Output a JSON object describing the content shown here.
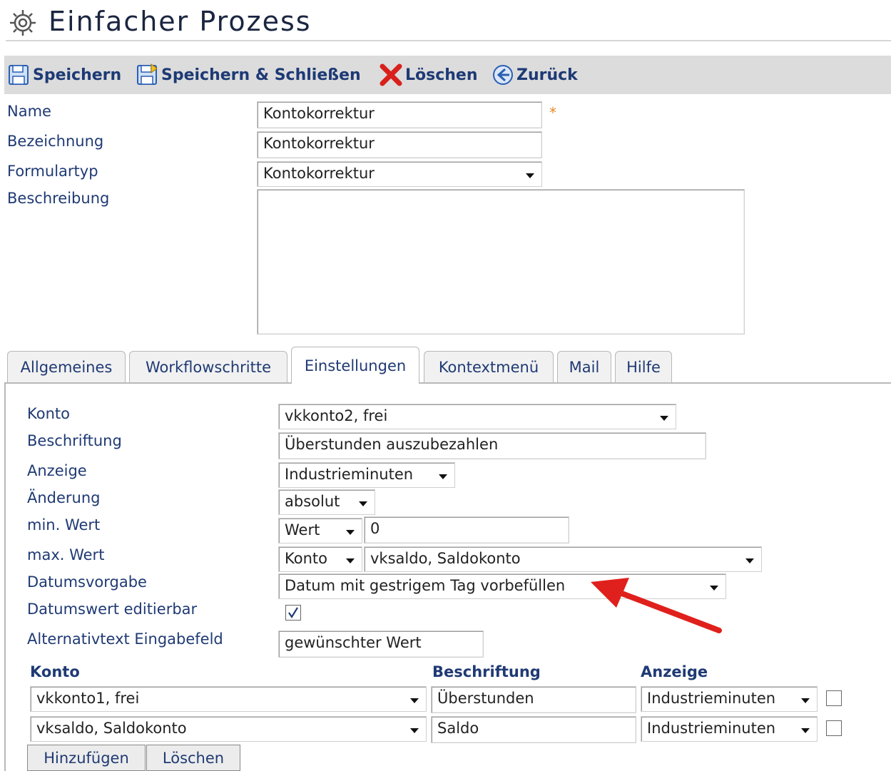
{
  "page": {
    "title": "Einfacher Prozess"
  },
  "toolbar": {
    "save": "Speichern",
    "save_close": "Speichern & Schließen",
    "delete": "Löschen",
    "back": "Zurück"
  },
  "form": {
    "name_label": "Name",
    "name_value": "Kontokorrektur",
    "required_mark": "*",
    "bezeichnung_label": "Bezeichnung",
    "bezeichnung_value": "Kontokorrektur",
    "formulartyp_label": "Formulartyp",
    "formulartyp_value": "Kontokorrektur",
    "beschreibung_label": "Beschreibung",
    "beschreibung_value": ""
  },
  "tabs": [
    {
      "label": "Allgemeines"
    },
    {
      "label": "Workflowschritte"
    },
    {
      "label": "Einstellungen"
    },
    {
      "label": "Kontextmenü"
    },
    {
      "label": "Mail"
    },
    {
      "label": "Hilfe"
    }
  ],
  "settings": {
    "konto_label": "Konto",
    "konto_value": "vkkonto2, frei",
    "beschriftung_label": "Beschriftung",
    "beschriftung_value": "Überstunden auszubezahlen",
    "anzeige_label": "Anzeige",
    "anzeige_value": "Industrieminuten",
    "aenderung_label": "Änderung",
    "aenderung_value": "absolut",
    "min_label": "min. Wert",
    "min_type": "Wert",
    "min_value": "0",
    "max_label": "max. Wert",
    "max_type": "Konto",
    "max_value": "vksaldo, Saldokonto",
    "datumsvorgabe_label": "Datumsvorgabe",
    "datumsvorgabe_value": "Datum mit gestrigem Tag vorbefüllen",
    "datumswert_label": "Datumswert editierbar",
    "datumswert_checked": true,
    "alttext_label": "Alternativtext Eingabefeld",
    "alttext_value": "gewünschter Wert"
  },
  "table": {
    "headers": {
      "konto": "Konto",
      "beschriftung": "Beschriftung",
      "anzeige": "Anzeige"
    },
    "rows": [
      {
        "konto": "vkkonto1, frei",
        "beschriftung": "Überstunden",
        "anzeige": "Industrieminuten",
        "checked": false
      },
      {
        "konto": "vksaldo, Saldokonto",
        "beschriftung": "Saldo",
        "anzeige": "Industrieminuten",
        "checked": false
      }
    ]
  },
  "buttons": {
    "add": "Hinzufügen",
    "delete": "Löschen"
  },
  "colors": {
    "label": "#1f3a74",
    "toolbar_bg": "#dcdcdc",
    "required": "#e8892a",
    "arrow": "#e0201c"
  },
  "icons": [
    "gear-icon",
    "save-icon",
    "save-close-icon",
    "delete-icon",
    "back-icon",
    "dropdown-caret-icon",
    "checkbox-check-icon",
    "annotation-arrow"
  ]
}
